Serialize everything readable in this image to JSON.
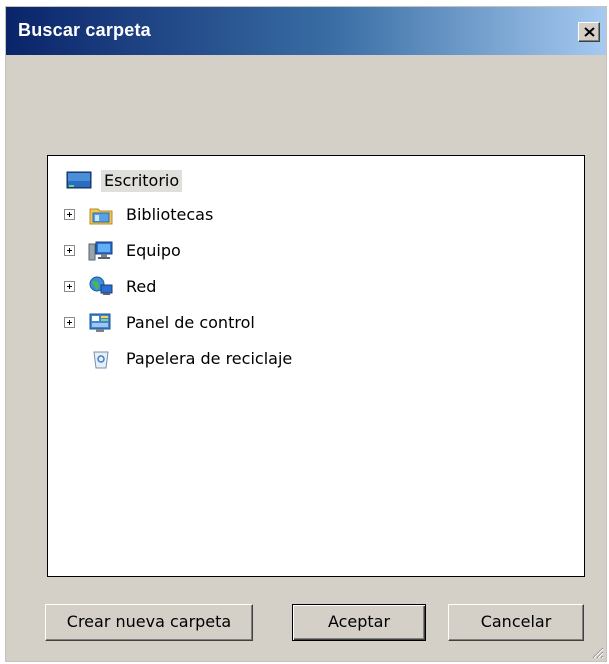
{
  "window": {
    "title": "Buscar carpeta",
    "close_glyph": "×"
  },
  "tree": {
    "items": [
      {
        "label": "Escritorio",
        "icon": "desktop-icon",
        "expandable": false,
        "selected": true
      },
      {
        "label": "Bibliotecas",
        "icon": "libraries-icon",
        "expandable": true,
        "selected": false
      },
      {
        "label": "Equipo",
        "icon": "computer-icon",
        "expandable": true,
        "selected": false
      },
      {
        "label": "Red",
        "icon": "network-icon",
        "expandable": true,
        "selected": false
      },
      {
        "label": "Panel de control",
        "icon": "control-panel-icon",
        "expandable": true,
        "selected": false
      },
      {
        "label": "Papelera de reciclaje",
        "icon": "recycle-bin-icon",
        "expandable": false,
        "selected": false
      }
    ]
  },
  "buttons": {
    "new_folder": "Crear nueva carpeta",
    "ok": "Aceptar",
    "cancel": "Cancelar"
  },
  "colors": {
    "title_gradient_start": "#0a246a",
    "title_gradient_end": "#a6caf0",
    "dialog_face": "#d4d0c8",
    "selection": "#e1dfdb"
  }
}
